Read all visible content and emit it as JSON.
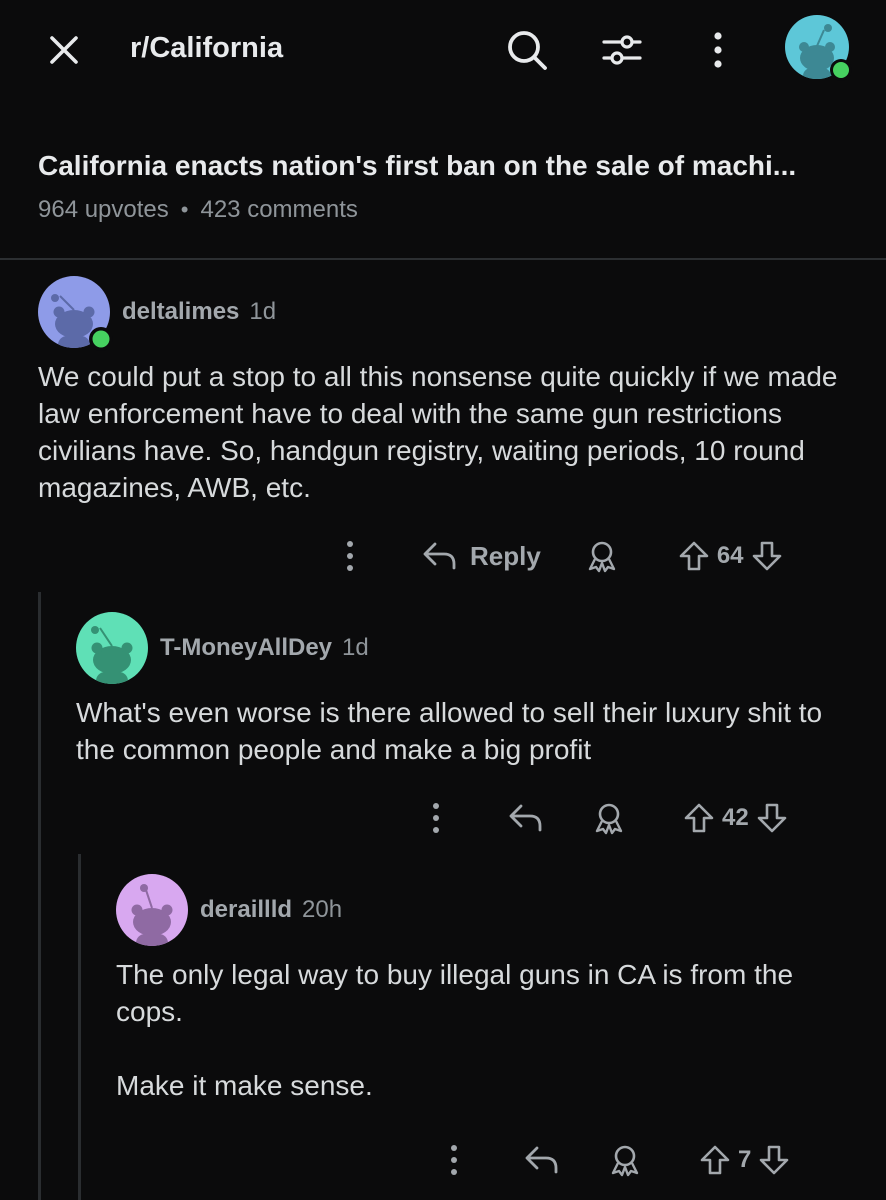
{
  "header": {
    "subreddit": "r/California",
    "icons": [
      "close-icon",
      "search-icon",
      "filter-icon",
      "more-vertical-icon",
      "snoo-avatar-icon"
    ]
  },
  "post": {
    "title": "California enacts nation's first ban on the sale of machi...",
    "upvotes": "964 upvotes",
    "separator": "•",
    "comments": "423 comments"
  },
  "comments": [
    {
      "username": "deltalimes",
      "age": "1d",
      "body": [
        "We could put a stop to all this nonsense quite quickly if we made law enforcement have to deal with the same gun restrictions civilians have. So, handgun registry, waiting periods, 10 round magazines, AWB, etc."
      ],
      "reply_label": "Reply",
      "score": "64",
      "avatar_color": "#8e9be8",
      "online": true
    },
    {
      "username": "T-MoneyAllDey",
      "age": "1d",
      "body": [
        "What's even worse is there allowed to sell their luxury shit to the common people and make a big profit"
      ],
      "score": "42",
      "avatar_color": "#5fe0b6",
      "online": false
    },
    {
      "username": "deraillld",
      "age": "20h",
      "body": [
        "The only legal way to buy illegal guns in CA is from the cops.",
        "Make it make sense."
      ],
      "score": "7",
      "avatar_color": "#d8a8f0",
      "online": false
    }
  ],
  "colors": {
    "background": "#0b0b0c",
    "text": "#d7dadc",
    "muted": "#8f959a",
    "online": "#46d160"
  }
}
